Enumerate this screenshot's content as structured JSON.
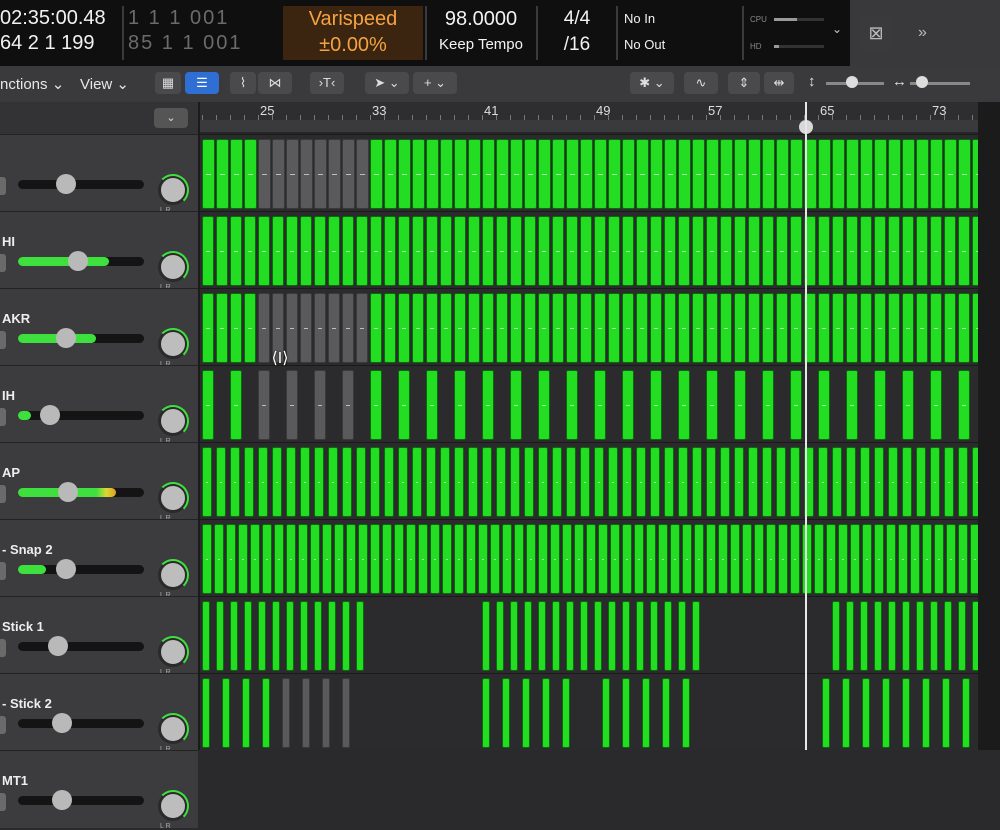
{
  "lcd": {
    "timecode_top": "02:35:00.48",
    "timecode_bottom": "64  2  1  199",
    "bars_top": "1  1  1  001",
    "bars_bottom": "85  1  1  001",
    "varispeed_label": "Varispeed",
    "varispeed_value": "±0.00%",
    "tempo": "98.0000",
    "tempo_mode": "Keep Tempo",
    "time_sig": "4/4",
    "division": "/16",
    "input": "No In",
    "output": "No Out",
    "cpu_label": "CPU",
    "hd_label": "HD",
    "cpu_load": 0.45,
    "hd_load": 0.1
  },
  "control_bar": {
    "functions_label": "nctions",
    "view_label": "View"
  },
  "ruler": {
    "bars": [
      "25",
      "33",
      "41",
      "49",
      "57",
      "65",
      "73"
    ]
  },
  "tracks": [
    {
      "name": "",
      "volume": 0.0,
      "knob": 0.38
    },
    {
      "name": "HI",
      "volume": 0.72,
      "knob": 0.48
    },
    {
      "name": "AKR",
      "volume": 0.62,
      "knob": 0.38
    },
    {
      "name": "IH",
      "volume": 0.1,
      "knob": 0.25
    },
    {
      "name": "AP",
      "volume": 0.78,
      "knob": 0.4
    },
    {
      "name": "- Snap 2",
      "volume": 0.22,
      "knob": 0.38
    },
    {
      "name": "Stick 1",
      "volume": 0.0,
      "knob": 0.32
    },
    {
      "name": "- Stick 2",
      "volume": 0.0,
      "knob": 0.35
    },
    {
      "name": "MT1",
      "volume": 0.0,
      "knob": 0.35
    }
  ],
  "colors": {
    "region_green": "#22dd22",
    "level_green": "#3ee03e",
    "varispeed_orange": "#f5a340",
    "selected_region": "#5a5a5c"
  }
}
